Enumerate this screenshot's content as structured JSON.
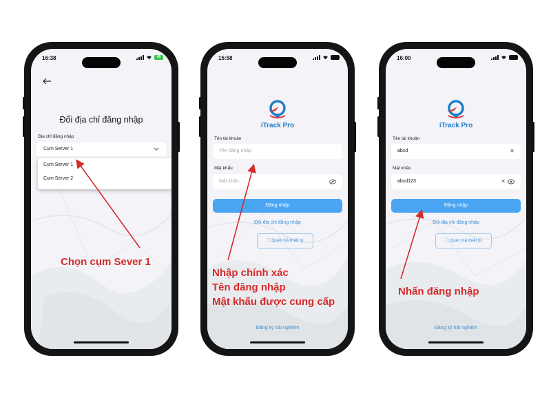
{
  "colors": {
    "accent": "#4aa5f2",
    "annotation": "#d62a2a",
    "link": "#3a8fd9",
    "brand": "#1e7ec8"
  },
  "phone1": {
    "time": "16:38",
    "battery": "45",
    "title": "Đổi địa chỉ đăng nhập",
    "field_label": "Địa chỉ đăng nhập",
    "selected": "Cụm Server 1",
    "options": [
      "Cụm Server 1",
      "Cụm Server 2"
    ]
  },
  "phone2": {
    "time": "15:58",
    "app_name": "iTrack Pro",
    "username_label": "Tên tài khoản",
    "username_placeholder": "Tên đăng nhập",
    "password_label": "Mật khẩu",
    "password_placeholder": "Mật khẩu",
    "login_button": "Đăng nhập",
    "change_address_link": "Đổi địa chỉ đăng nhập",
    "scan_button": "Quét mã thiết bị",
    "register_link": "Đăng ký trải nghiệm"
  },
  "phone3": {
    "time": "16:00",
    "app_name": "iTrack Pro",
    "username_label": "Tên tài khoản",
    "username_value": "abcd",
    "password_label": "Mật khẩu",
    "password_value": "abcd123",
    "login_button": "Đăng nhập",
    "change_address_link": "Đổi địa chỉ đăng nhập",
    "scan_button": "Quét mã thiết bị",
    "register_link": "Đăng ký trải nghiệm"
  },
  "annotations": {
    "step1": "Chọn cụm Sever 1",
    "step2_line1": "Nhập chính xác",
    "step2_line2": "Tên đăng nhập",
    "step2_line3": "Mật khẩu được cung cấp",
    "step3": "Nhấn đăng nhập"
  }
}
